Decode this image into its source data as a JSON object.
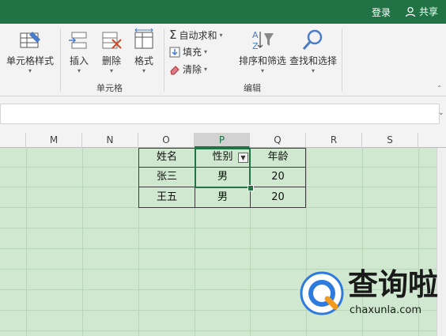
{
  "titlebar": {
    "login": "登录",
    "share": "共享"
  },
  "ribbon": {
    "cell_style": "单元格样式",
    "insert": "插入",
    "delete": "删除",
    "format": "格式",
    "cells_group": "单元格",
    "autosum": "自动求和",
    "fill": "填充",
    "clear": "清除",
    "sort_filter": "排序和筛选",
    "find_select": "查找和选择",
    "edit_group": "编辑"
  },
  "columns": [
    "M",
    "N",
    "O",
    "P",
    "Q",
    "R",
    "S"
  ],
  "table": {
    "headers": [
      "姓名",
      "性别",
      "年龄"
    ],
    "rows": [
      [
        "张三",
        "男",
        "20"
      ],
      [
        "王五",
        "男",
        "20"
      ]
    ]
  },
  "watermark": {
    "brand": "查询啦",
    "url": "chaxunla.com"
  },
  "colors": {
    "accent": "#217346",
    "selection": "#cfe8cf"
  }
}
